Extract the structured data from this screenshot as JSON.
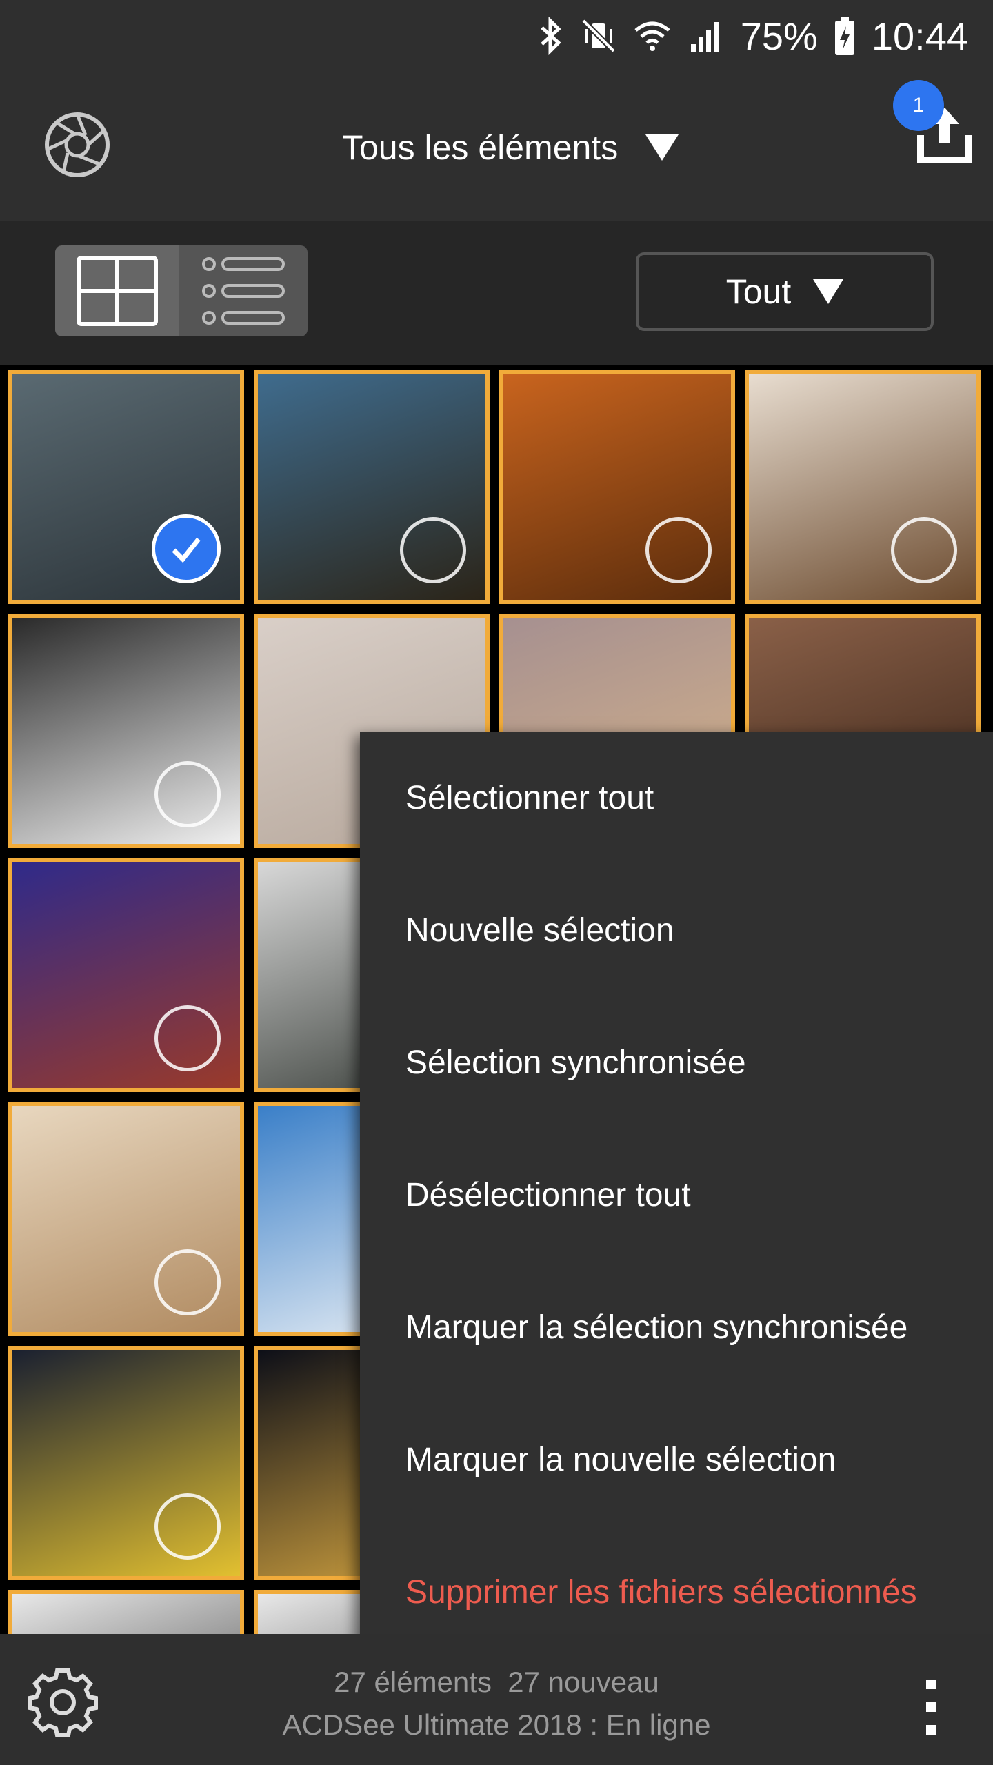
{
  "status": {
    "battery": "75%",
    "time": "10:44",
    "icons": [
      "bluetooth-icon",
      "vibrate-icon",
      "wifi-icon",
      "signal-icon",
      "battery-icon"
    ]
  },
  "appbar": {
    "title": "Tous les éléments",
    "upload_badge": "1",
    "icons": [
      "aperture-icon",
      "chevron-down-icon",
      "upload-icon"
    ]
  },
  "toolbar": {
    "filter_label": "Tout",
    "view_modes": [
      "grid-view-icon",
      "list-view-icon"
    ]
  },
  "grid": {
    "columns": 4,
    "thumbnails": [
      {
        "subject": "sea with seagull",
        "selected": true,
        "colors": [
          "#5a6a72",
          "#2b3338"
        ]
      },
      {
        "subject": "coastline",
        "selected": false,
        "colors": [
          "#3f6c8e",
          "#2b2418"
        ]
      },
      {
        "subject": "autumn forest path",
        "selected": false,
        "colors": [
          "#c9641e",
          "#5a2c0c"
        ]
      },
      {
        "subject": "chocolate cake",
        "selected": false,
        "colors": [
          "#e8ddd0",
          "#6b4a2e"
        ]
      },
      {
        "subject": "snow gradient",
        "selected": false,
        "colors": [
          "#2a2a2a",
          "#f0f0f0"
        ]
      },
      {
        "subject": "woman in snow",
        "selected": false,
        "colors": [
          "#d9cfc8",
          "#b7a89c"
        ]
      },
      {
        "subject": "sunset",
        "selected": false,
        "colors": [
          "#a69090",
          "#d7b48a"
        ]
      },
      {
        "subject": "building facade",
        "selected": false,
        "colors": [
          "#8a6048",
          "#3a2418"
        ]
      },
      {
        "subject": "graffiti face",
        "selected": false,
        "colors": [
          "#2f2a8a",
          "#9a3a2a"
        ]
      },
      {
        "subject": "snowy trees",
        "selected": false,
        "colors": [
          "#d8d8d8",
          "#3a3f3a"
        ]
      },
      {
        "subject": "hidden",
        "selected": false,
        "colors": [
          "#333333",
          "#333333"
        ]
      },
      {
        "subject": "hidden",
        "selected": false,
        "colors": [
          "#333333",
          "#333333"
        ]
      },
      {
        "subject": "bright hall",
        "selected": false,
        "colors": [
          "#e8d7bf",
          "#b08a60"
        ]
      },
      {
        "subject": "bird in sky",
        "selected": false,
        "colors": [
          "#3a7fc8",
          "#eef2f6"
        ]
      },
      {
        "subject": "hidden",
        "selected": false,
        "colors": [
          "#333333",
          "#333333"
        ]
      },
      {
        "subject": "hidden",
        "selected": false,
        "colors": [
          "#333333",
          "#333333"
        ]
      },
      {
        "subject": "yellow tulips",
        "selected": false,
        "colors": [
          "#1a2030",
          "#e2c030"
        ]
      },
      {
        "subject": "yellow flower",
        "selected": false,
        "colors": [
          "#0d0f18",
          "#d6a640"
        ]
      }
    ]
  },
  "menu": {
    "items": [
      "Sélectionner tout",
      "Nouvelle sélection",
      "Sélection synchronisée",
      "Désélectionner tout",
      "Marquer la sélection synchronisée",
      "Marquer la nouvelle sélection",
      "Supprimer les fichiers sélectionnés"
    ],
    "danger_color": "#ee5c4f"
  },
  "bottombar": {
    "count_elements": "27 éléments",
    "count_new": "27 nouveau",
    "status": "ACDSee Ultimate 2018 : En ligne",
    "icons": [
      "settings-icon",
      "overflow-menu-icon"
    ]
  },
  "colors": {
    "accent_border": "#f1ab3a",
    "select_blue": "#2d75f0",
    "bar_bg": "#2f2f2f"
  }
}
